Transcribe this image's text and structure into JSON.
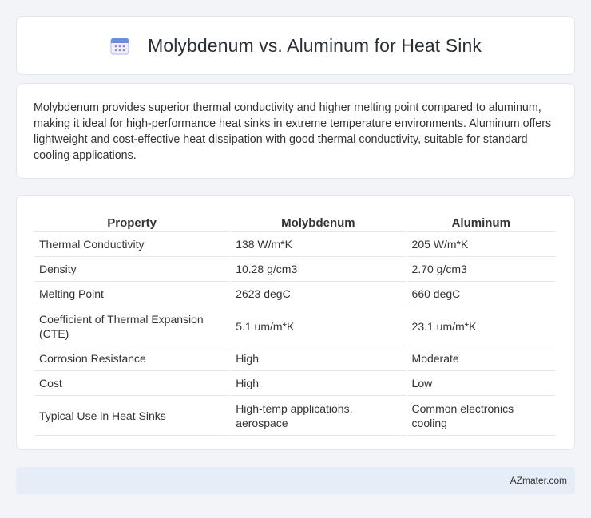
{
  "header": {
    "icon": "calendar-icon",
    "title": "Molybdenum vs. Aluminum for Heat Sink"
  },
  "summary": {
    "text": "Molybdenum provides superior thermal conductivity and higher melting point compared to aluminum, making it ideal for high-performance heat sinks in extreme temperature environments. Aluminum offers lightweight and cost-effective heat dissipation with good thermal conductivity, suitable for standard cooling applications."
  },
  "table": {
    "headers": [
      "Property",
      "Molybdenum",
      "Aluminum"
    ],
    "rows": [
      [
        "Thermal Conductivity",
        "138 W/m*K",
        "205 W/m*K"
      ],
      [
        "Density",
        "10.28 g/cm3",
        "2.70 g/cm3"
      ],
      [
        "Melting Point",
        "2623 degC",
        "660 degC"
      ],
      [
        "Coefficient of Thermal Expansion (CTE)",
        "5.1 um/m*K",
        "23.1 um/m*K"
      ],
      [
        "Corrosion Resistance",
        "High",
        "Moderate"
      ],
      [
        "Cost",
        "High",
        "Low"
      ],
      [
        "Typical Use in Heat Sinks",
        "High-temp applications, aerospace",
        "Common electronics cooling"
      ]
    ]
  },
  "footer": {
    "brand": "AZmater.com"
  },
  "colors": {
    "page_background": "#f2f4f8",
    "card_background": "#ffffff",
    "footer_background": "#e6edf7",
    "icon_accent": "#6b8fd6"
  }
}
